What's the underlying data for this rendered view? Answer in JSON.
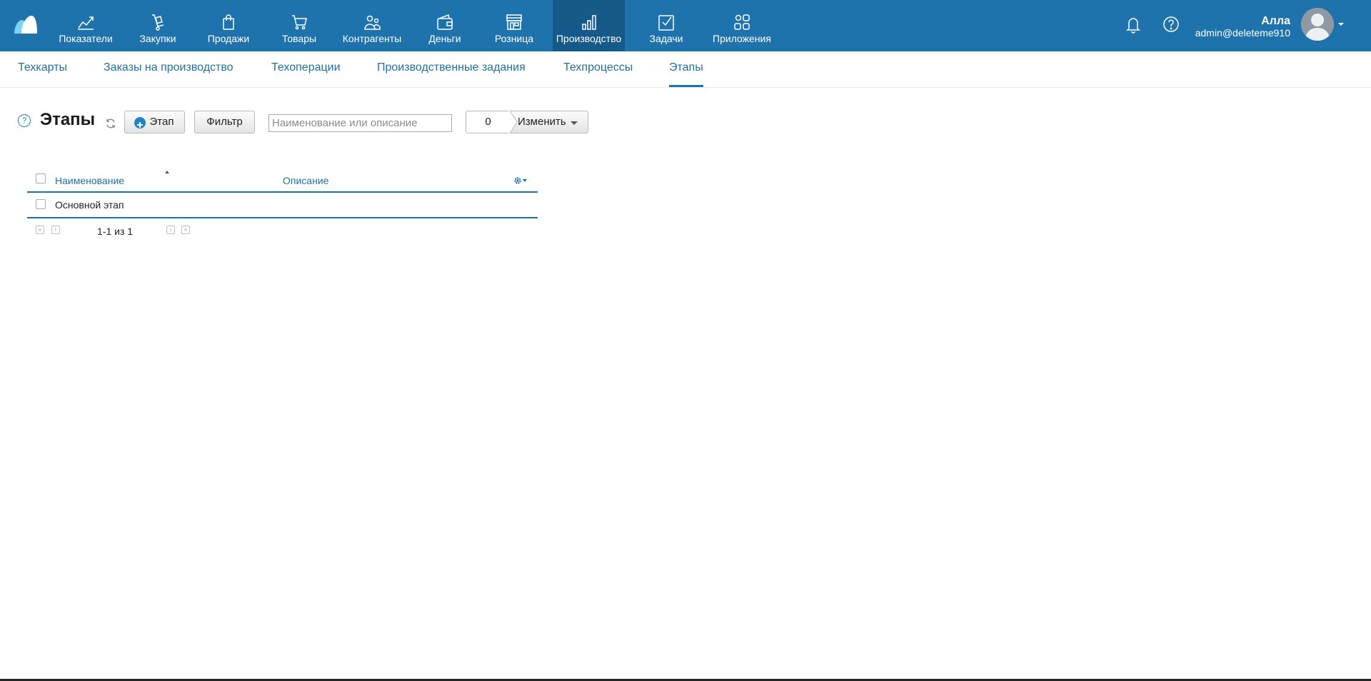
{
  "topnav": {
    "items": [
      {
        "label": "Показатели",
        "icon": "chart-line-icon"
      },
      {
        "label": "Закупки",
        "icon": "hand-truck-icon"
      },
      {
        "label": "Продажи",
        "icon": "shopping-bag-icon"
      },
      {
        "label": "Товары",
        "icon": "cart-icon"
      },
      {
        "label": "Контрагенты",
        "icon": "people-icon"
      },
      {
        "label": "Деньги",
        "icon": "wallet-icon"
      },
      {
        "label": "Розница",
        "icon": "store-icon"
      },
      {
        "label": "Производство",
        "icon": "factory-chart-icon",
        "active": true
      },
      {
        "label": "Задачи",
        "icon": "checkbox-icon"
      },
      {
        "label": "Приложения",
        "icon": "apps-grid-icon"
      }
    ],
    "user": {
      "name": "Алла",
      "email": "admin@deleteme910"
    }
  },
  "subnav": {
    "items": [
      {
        "label": "Техкарты"
      },
      {
        "label": "Заказы на производство"
      },
      {
        "label": "Техоперации"
      },
      {
        "label": "Производственные задания"
      },
      {
        "label": "Техпроцессы"
      },
      {
        "label": "Этапы",
        "active": true
      }
    ]
  },
  "toolbar": {
    "help_glyph": "?",
    "title": "Этапы",
    "add_label": "Этап",
    "filter_label": "Фильтр",
    "search_placeholder": "Наименование или описание",
    "search_value": "",
    "selected_count": "0",
    "change_label": "Изменить"
  },
  "table": {
    "columns": [
      "Наименование",
      "Описание"
    ],
    "rows": [
      {
        "name": "Основной этап",
        "description": ""
      }
    ]
  },
  "pager": {
    "text": "1-1 из 1"
  },
  "colors": {
    "primary": "#1f73ad",
    "primary_dark": "#165a8a",
    "link": "#1f6fa5"
  }
}
